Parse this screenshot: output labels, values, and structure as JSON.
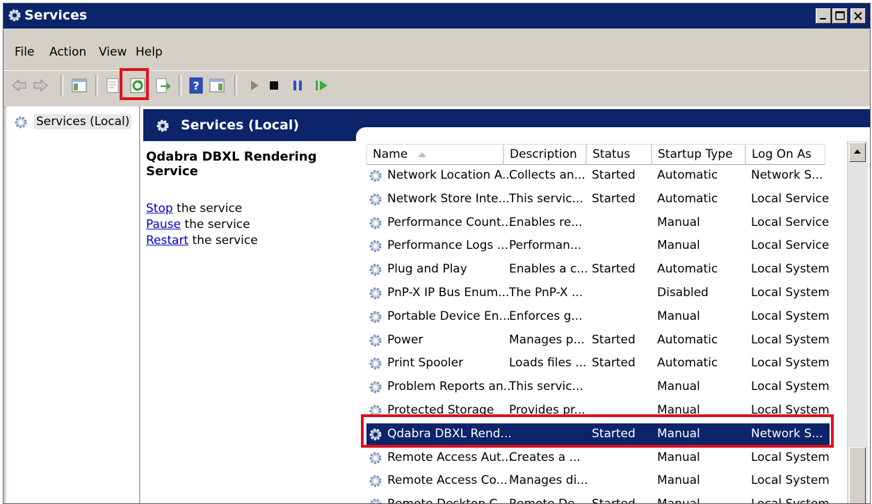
{
  "window": {
    "title": "Services"
  },
  "menu": [
    "File",
    "Action",
    "View",
    "Help"
  ],
  "toolbar": [
    "back-icon",
    "forward-icon",
    "show-hide-tree-icon",
    "properties-icon",
    "refresh-icon",
    "export-list-icon",
    "help-icon",
    "show-action-pane-icon",
    "start-service-icon",
    "stop-service-icon",
    "pause-service-icon",
    "resume-service-icon"
  ],
  "tree": {
    "root": "Services (Local)"
  },
  "pane": {
    "header": "Services (Local)",
    "detail_title": "Qdabra DBXL Rendering Service",
    "actions": [
      {
        "link": "Stop",
        "suffix": " the service"
      },
      {
        "link": "Pause",
        "suffix": " the service"
      },
      {
        "link": "Restart",
        "suffix": " the service"
      }
    ]
  },
  "table": {
    "columns": [
      "Name",
      "Description",
      "Status",
      "Startup Type",
      "Log On As"
    ],
    "rows": [
      [
        "Network Location A...",
        "Collects an...",
        "Started",
        "Automatic",
        "Network S..."
      ],
      [
        "Network Store Inte...",
        "This servic...",
        "Started",
        "Automatic",
        "Local Service"
      ],
      [
        "Performance Count...",
        "Enables re...",
        "",
        "Manual",
        "Local Service"
      ],
      [
        "Performance Logs ...",
        "Performan...",
        "",
        "Manual",
        "Local Service"
      ],
      [
        "Plug and Play",
        "Enables a c...",
        "Started",
        "Automatic",
        "Local System"
      ],
      [
        "PnP-X IP Bus Enum...",
        "The PnP-X ...",
        "",
        "Disabled",
        "Local System"
      ],
      [
        "Portable Device En...",
        "Enforces g...",
        "",
        "Manual",
        "Local System"
      ],
      [
        "Power",
        "Manages p...",
        "Started",
        "Automatic",
        "Local System"
      ],
      [
        "Print Spooler",
        "Loads files ...",
        "Started",
        "Automatic",
        "Local System"
      ],
      [
        "Problem Reports an...",
        "This servic...",
        "",
        "Manual",
        "Local System"
      ],
      [
        "Protected Storage",
        "Provides pr...",
        "",
        "Manual",
        "Local System"
      ],
      [
        "Qdabra DBXL Rend...",
        "",
        "Started",
        "Manual",
        "Network S..."
      ],
      [
        "Remote Access Aut...",
        "Creates a ...",
        "",
        "Manual",
        "Local System"
      ],
      [
        "Remote Access Co...",
        "Manages di...",
        "",
        "Manual",
        "Local System"
      ],
      [
        "Remote Desktop C...",
        "Remote De...",
        "Started",
        "Manual",
        "Local System"
      ]
    ],
    "selected_index": 11
  },
  "colors": {
    "titlebar": "#0c246a",
    "highlight": "#e0101a",
    "selected_row": "#0c246a"
  }
}
